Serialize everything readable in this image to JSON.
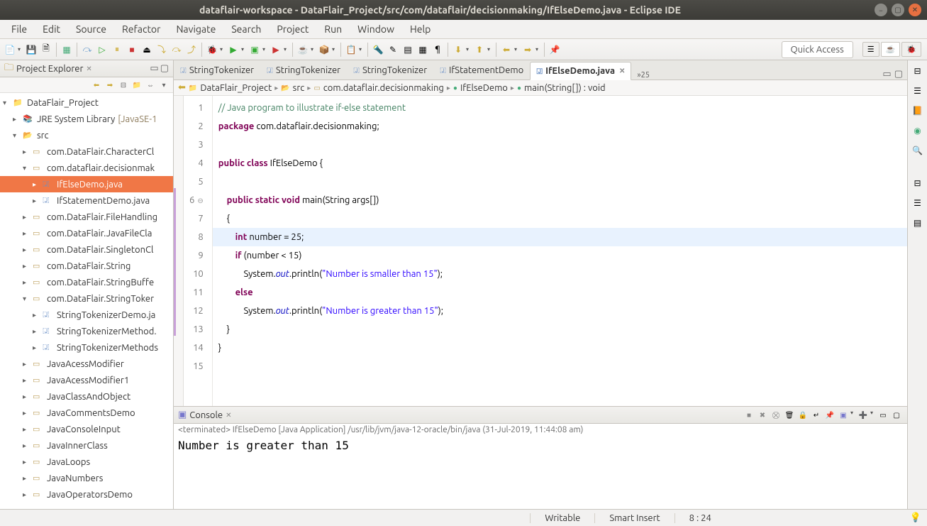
{
  "window": {
    "title": "dataflair-workspace - DataFlair_Project/src/com/dataflair/decisionmaking/IfElseDemo.java - Eclipse IDE"
  },
  "menu": [
    "File",
    "Edit",
    "Source",
    "Refactor",
    "Navigate",
    "Search",
    "Project",
    "Run",
    "Window",
    "Help"
  ],
  "quick_access": "Quick Access",
  "explorer": {
    "title": "Project Explorer",
    "items": [
      {
        "level": 0,
        "expanded": true,
        "icon": "project",
        "label": "DataFlair_Project"
      },
      {
        "level": 1,
        "expanded": false,
        "arrow": true,
        "icon": "lib",
        "label": "JRE System Library",
        "suffix": "[JavaSE-1"
      },
      {
        "level": 1,
        "expanded": true,
        "arrow": true,
        "icon": "srcfolder",
        "label": "src"
      },
      {
        "level": 2,
        "expanded": false,
        "arrow": true,
        "icon": "pkg",
        "label": "com.DataFlair.CharacterCl"
      },
      {
        "level": 2,
        "expanded": true,
        "arrow": true,
        "icon": "pkg",
        "label": "com.dataflair.decisionmak"
      },
      {
        "level": 3,
        "expanded": false,
        "arrow": true,
        "icon": "java",
        "label": "IfElseDemo.java",
        "selected": true
      },
      {
        "level": 3,
        "expanded": false,
        "arrow": true,
        "icon": "java",
        "label": "IfStatementDemo.java"
      },
      {
        "level": 2,
        "expanded": false,
        "arrow": true,
        "icon": "pkg",
        "label": "com.DataFlair.FileHandling"
      },
      {
        "level": 2,
        "expanded": false,
        "arrow": true,
        "icon": "pkg",
        "label": "com.DataFlair.JavaFileCla"
      },
      {
        "level": 2,
        "expanded": false,
        "arrow": true,
        "icon": "pkg",
        "label": "com.DataFlair.SingletonCl"
      },
      {
        "level": 2,
        "expanded": false,
        "arrow": true,
        "icon": "pkg",
        "label": "com.DataFlair.String"
      },
      {
        "level": 2,
        "expanded": false,
        "arrow": true,
        "icon": "pkg",
        "label": "com.DataFlair.StringBuffe"
      },
      {
        "level": 2,
        "expanded": true,
        "arrow": true,
        "icon": "pkg",
        "label": "com.DataFlair.StringToker"
      },
      {
        "level": 3,
        "expanded": false,
        "arrow": true,
        "icon": "java",
        "label": "StringTokenizerDemo.ja"
      },
      {
        "level": 3,
        "expanded": false,
        "arrow": true,
        "icon": "java",
        "label": "StringTokenizerMethod."
      },
      {
        "level": 3,
        "expanded": false,
        "arrow": true,
        "icon": "java",
        "label": "StringTokenizerMethods"
      },
      {
        "level": 2,
        "expanded": false,
        "arrow": true,
        "icon": "pkg",
        "label": "JavaAcessModifier"
      },
      {
        "level": 2,
        "expanded": false,
        "arrow": true,
        "icon": "pkg",
        "label": "JavaAcessModifier1"
      },
      {
        "level": 2,
        "expanded": false,
        "arrow": true,
        "icon": "pkg",
        "label": "JavaClassAndObject"
      },
      {
        "level": 2,
        "expanded": false,
        "arrow": true,
        "icon": "pkg",
        "label": "JavaCommentsDemo"
      },
      {
        "level": 2,
        "expanded": false,
        "arrow": true,
        "icon": "pkg",
        "label": "JavaConsoleInput"
      },
      {
        "level": 2,
        "expanded": false,
        "arrow": true,
        "icon": "pkg",
        "label": "JavaInnerClass"
      },
      {
        "level": 2,
        "expanded": false,
        "arrow": true,
        "icon": "pkg",
        "label": "JavaLoops"
      },
      {
        "level": 2,
        "expanded": false,
        "arrow": true,
        "icon": "pkg",
        "label": "JavaNumbers"
      },
      {
        "level": 2,
        "expanded": false,
        "arrow": true,
        "icon": "pkg",
        "label": "JavaOperatorsDemo"
      }
    ]
  },
  "tabs": [
    {
      "label": "StringTokenizer",
      "icon": "java"
    },
    {
      "label": "StringTokenizer",
      "icon": "java"
    },
    {
      "label": "StringTokenizer",
      "icon": "java"
    },
    {
      "label": "IfStatementDemo",
      "icon": "java"
    },
    {
      "label": "IfElseDemo.java",
      "icon": "java",
      "active": true
    }
  ],
  "tab_overflow": "»25",
  "breadcrumb": [
    {
      "icon": "project",
      "label": "DataFlair_Project"
    },
    {
      "icon": "srcfolder",
      "label": "src"
    },
    {
      "icon": "pkg",
      "label": "com.dataflair.decisionmaking"
    },
    {
      "icon": "class",
      "label": "IfElseDemo"
    },
    {
      "icon": "method",
      "label": "main(String[]) : void"
    }
  ],
  "code": {
    "lines": [
      {
        "n": 1,
        "html": "<span class='comment'>// Java program to illustrate if-else statement</span>"
      },
      {
        "n": 2,
        "html": "<span class='kw'>package</span> com.dataflair.decisionmaking;"
      },
      {
        "n": 3,
        "html": ""
      },
      {
        "n": 4,
        "html": "<span class='kw'>public</span> <span class='kw'>class</span> IfElseDemo {"
      },
      {
        "n": 5,
        "html": ""
      },
      {
        "n": 6,
        "html": "    <span class='kw'>public</span> <span class='kw'>static</span> <span class='kw'>void</span> main(String args[])",
        "foldable": true
      },
      {
        "n": 7,
        "html": "    {"
      },
      {
        "n": 8,
        "html": "        <span class='kw'>int</span> number = 25;",
        "highlight": true
      },
      {
        "n": 9,
        "html": "        <span class='kw'>if</span> (number &lt; 15)"
      },
      {
        "n": 10,
        "html": "            System.<span class='field'>out</span>.println(<span class='string'>\"Number is smaller than 15\"</span>);"
      },
      {
        "n": 11,
        "html": "        <span class='kw'>else</span>"
      },
      {
        "n": 12,
        "html": "            System.<span class='field'>out</span>.println(<span class='string'>\"Number is greater than 15\"</span>);"
      },
      {
        "n": 13,
        "html": "    }"
      },
      {
        "n": 14,
        "html": "}"
      },
      {
        "n": 15,
        "html": ""
      }
    ]
  },
  "console": {
    "title": "Console",
    "status": "<terminated> IfElseDemo [Java Application] /usr/lib/jvm/java-12-oracle/bin/java (31-Jul-2019, 11:44:08 am)",
    "output": "Number is greater than 15"
  },
  "status": {
    "writable": "Writable",
    "insert": "Smart Insert",
    "pos": "8 : 24"
  }
}
